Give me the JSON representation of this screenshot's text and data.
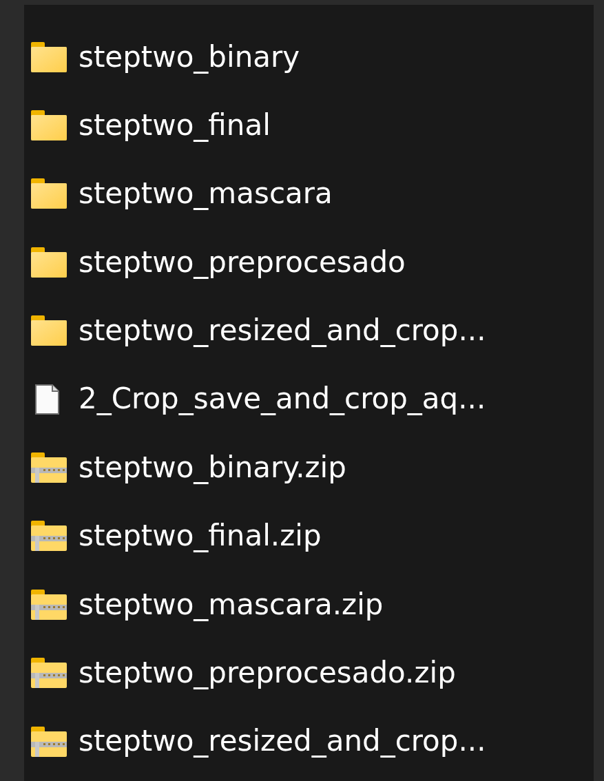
{
  "files": [
    {
      "name": "steptwo_binary",
      "kind": "folder"
    },
    {
      "name": "steptwo_final",
      "kind": "folder"
    },
    {
      "name": "steptwo_mascara",
      "kind": "folder"
    },
    {
      "name": "steptwo_preprocesado",
      "kind": "folder"
    },
    {
      "name": "steptwo_resized_and_crop...",
      "kind": "folder"
    },
    {
      "name": "2_Crop_save_and_crop_aq...",
      "kind": "file"
    },
    {
      "name": "steptwo_binary.zip",
      "kind": "zip"
    },
    {
      "name": "steptwo_final.zip",
      "kind": "zip"
    },
    {
      "name": "steptwo_mascara.zip",
      "kind": "zip"
    },
    {
      "name": "steptwo_preprocesado.zip",
      "kind": "zip"
    },
    {
      "name": "steptwo_resized_and_crop...",
      "kind": "zip"
    }
  ]
}
